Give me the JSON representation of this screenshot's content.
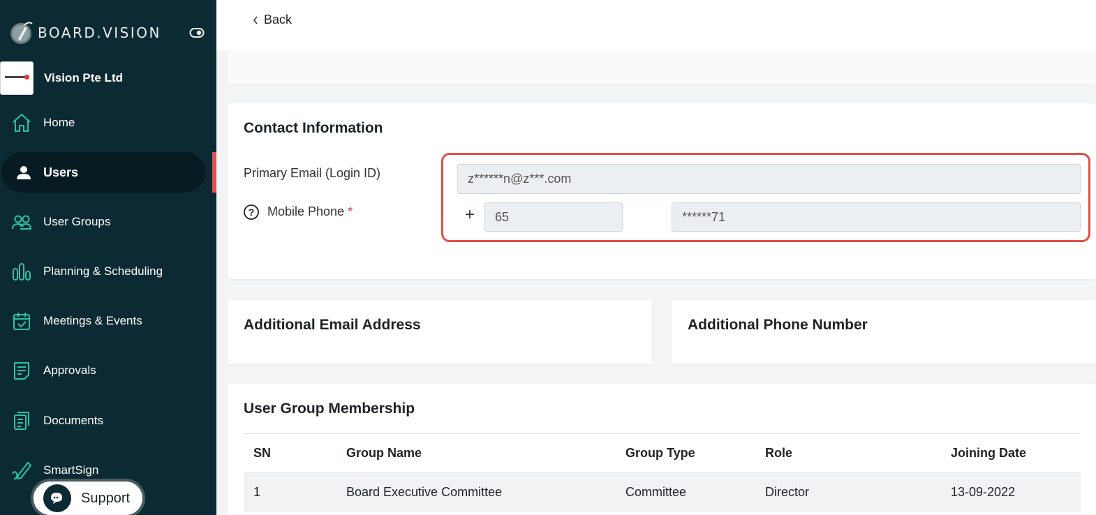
{
  "brand": {
    "name": "BOARD.VISION"
  },
  "org": {
    "name": "Vision Pte Ltd"
  },
  "nav": [
    {
      "label": "Home",
      "icon": "home-icon"
    },
    {
      "label": "Users",
      "icon": "user-icon",
      "active": true
    },
    {
      "label": "User Groups",
      "icon": "user-groups-icon"
    },
    {
      "label": "Planning & Scheduling",
      "icon": "bars-icon"
    },
    {
      "label": "Meetings & Events",
      "icon": "calendar-check-icon"
    },
    {
      "label": "Approvals",
      "icon": "approvals-icon"
    },
    {
      "label": "Documents",
      "icon": "documents-icon"
    },
    {
      "label": "SmartSign",
      "icon": "pen-icon"
    }
  ],
  "support": {
    "label": "Support"
  },
  "back": {
    "label": "Back"
  },
  "contact": {
    "title": "Contact Information",
    "email_label": "Primary Email (Login ID)",
    "email_value": "z******n@z***.com",
    "phone_label": "Mobile Phone",
    "required_mark": "*",
    "plus": "+",
    "country_code": "65",
    "phone_value": "******71"
  },
  "additional_email": {
    "title": "Additional Email Address"
  },
  "additional_phone": {
    "title": "Additional Phone Number"
  },
  "groups": {
    "title": "User Group Membership",
    "columns": [
      "SN",
      "Group Name",
      "Group Type",
      "Role",
      "Joining Date"
    ],
    "rows": [
      [
        "1",
        "Board Executive Committee",
        "Committee",
        "Director",
        "13-09-2022"
      ]
    ]
  },
  "colors": {
    "sidebar_bg": "#0c2a33",
    "accent_green": "#2bc4a4",
    "active_marker": "#e05353",
    "highlight_border": "#e04f45"
  }
}
